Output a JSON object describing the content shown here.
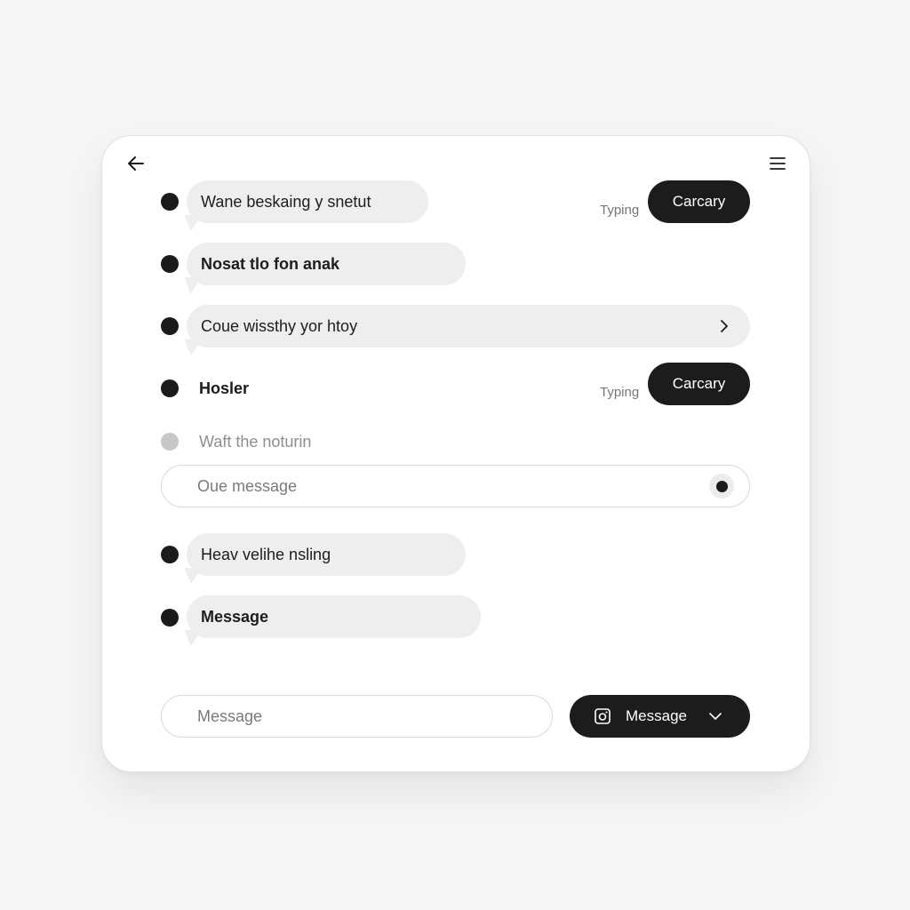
{
  "header": {
    "back_icon": "arrow-left-icon",
    "menu_icon": "hamburger-menu-icon"
  },
  "messages": [
    {
      "text": "Wane beskaing y snetut"
    },
    {
      "text": "Nosat tlo fon anak"
    },
    {
      "text": "Coue wissthy yor htoy",
      "chevron_icon": "chevron-right-icon"
    },
    {
      "text": "Hosler"
    },
    {
      "text": "Waft the noturin"
    },
    {
      "text": "Heav velihe nsling"
    },
    {
      "text": "Message"
    }
  ],
  "actions": [
    {
      "typing": "Typing",
      "button": "Carcary"
    },
    {
      "typing": "Typing",
      "button": "Carcary"
    }
  ],
  "inline_input": {
    "placeholder": "Oue message",
    "radio_icon": "radio-selected-icon"
  },
  "composer": {
    "placeholder": "Message",
    "send_label": "Message",
    "send_icon": "camera-icon",
    "dropdown_icon": "chevron-down-icon"
  },
  "colors": {
    "dark": "#1c1c1c",
    "bubble": "#eeeeee",
    "background": "#f6f6f6"
  }
}
